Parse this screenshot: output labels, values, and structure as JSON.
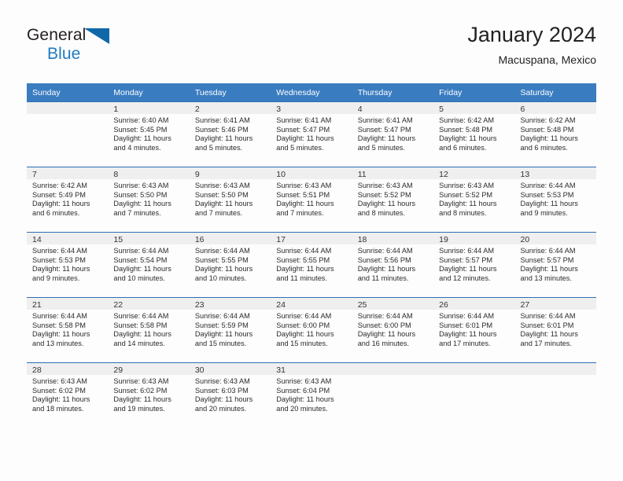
{
  "brand": {
    "name_part1": "General",
    "name_part2": "Blue",
    "logo_icon": "blue-triangle-flag-icon"
  },
  "header": {
    "title": "January 2024",
    "subtitle": "Macuspana, Mexico"
  },
  "colors": {
    "header_blue": "#3a7cc0",
    "grid_line_blue": "#2d6fb5",
    "daybar_gray": "#efefef",
    "brand_blue": "#1f7ac0",
    "logo_triangle": "#1068a8"
  },
  "calendar": {
    "weekday_headers": [
      "Sunday",
      "Monday",
      "Tuesday",
      "Wednesday",
      "Thursday",
      "Friday",
      "Saturday"
    ],
    "weeks": [
      [
        {
          "day": "",
          "sunrise": "",
          "sunset": "",
          "daylight_line1": "",
          "daylight_line2": "",
          "empty": true
        },
        {
          "day": "1",
          "sunrise": "Sunrise: 6:40 AM",
          "sunset": "Sunset: 5:45 PM",
          "daylight_line1": "Daylight: 11 hours",
          "daylight_line2": "and 4 minutes."
        },
        {
          "day": "2",
          "sunrise": "Sunrise: 6:41 AM",
          "sunset": "Sunset: 5:46 PM",
          "daylight_line1": "Daylight: 11 hours",
          "daylight_line2": "and 5 minutes."
        },
        {
          "day": "3",
          "sunrise": "Sunrise: 6:41 AM",
          "sunset": "Sunset: 5:47 PM",
          "daylight_line1": "Daylight: 11 hours",
          "daylight_line2": "and 5 minutes."
        },
        {
          "day": "4",
          "sunrise": "Sunrise: 6:41 AM",
          "sunset": "Sunset: 5:47 PM",
          "daylight_line1": "Daylight: 11 hours",
          "daylight_line2": "and 5 minutes."
        },
        {
          "day": "5",
          "sunrise": "Sunrise: 6:42 AM",
          "sunset": "Sunset: 5:48 PM",
          "daylight_line1": "Daylight: 11 hours",
          "daylight_line2": "and 6 minutes."
        },
        {
          "day": "6",
          "sunrise": "Sunrise: 6:42 AM",
          "sunset": "Sunset: 5:48 PM",
          "daylight_line1": "Daylight: 11 hours",
          "daylight_line2": "and 6 minutes."
        }
      ],
      [
        {
          "day": "7",
          "sunrise": "Sunrise: 6:42 AM",
          "sunset": "Sunset: 5:49 PM",
          "daylight_line1": "Daylight: 11 hours",
          "daylight_line2": "and 6 minutes."
        },
        {
          "day": "8",
          "sunrise": "Sunrise: 6:43 AM",
          "sunset": "Sunset: 5:50 PM",
          "daylight_line1": "Daylight: 11 hours",
          "daylight_line2": "and 7 minutes."
        },
        {
          "day": "9",
          "sunrise": "Sunrise: 6:43 AM",
          "sunset": "Sunset: 5:50 PM",
          "daylight_line1": "Daylight: 11 hours",
          "daylight_line2": "and 7 minutes."
        },
        {
          "day": "10",
          "sunrise": "Sunrise: 6:43 AM",
          "sunset": "Sunset: 5:51 PM",
          "daylight_line1": "Daylight: 11 hours",
          "daylight_line2": "and 7 minutes."
        },
        {
          "day": "11",
          "sunrise": "Sunrise: 6:43 AM",
          "sunset": "Sunset: 5:52 PM",
          "daylight_line1": "Daylight: 11 hours",
          "daylight_line2": "and 8 minutes."
        },
        {
          "day": "12",
          "sunrise": "Sunrise: 6:43 AM",
          "sunset": "Sunset: 5:52 PM",
          "daylight_line1": "Daylight: 11 hours",
          "daylight_line2": "and 8 minutes."
        },
        {
          "day": "13",
          "sunrise": "Sunrise: 6:44 AM",
          "sunset": "Sunset: 5:53 PM",
          "daylight_line1": "Daylight: 11 hours",
          "daylight_line2": "and 9 minutes."
        }
      ],
      [
        {
          "day": "14",
          "sunrise": "Sunrise: 6:44 AM",
          "sunset": "Sunset: 5:53 PM",
          "daylight_line1": "Daylight: 11 hours",
          "daylight_line2": "and 9 minutes."
        },
        {
          "day": "15",
          "sunrise": "Sunrise: 6:44 AM",
          "sunset": "Sunset: 5:54 PM",
          "daylight_line1": "Daylight: 11 hours",
          "daylight_line2": "and 10 minutes."
        },
        {
          "day": "16",
          "sunrise": "Sunrise: 6:44 AM",
          "sunset": "Sunset: 5:55 PM",
          "daylight_line1": "Daylight: 11 hours",
          "daylight_line2": "and 10 minutes."
        },
        {
          "day": "17",
          "sunrise": "Sunrise: 6:44 AM",
          "sunset": "Sunset: 5:55 PM",
          "daylight_line1": "Daylight: 11 hours",
          "daylight_line2": "and 11 minutes."
        },
        {
          "day": "18",
          "sunrise": "Sunrise: 6:44 AM",
          "sunset": "Sunset: 5:56 PM",
          "daylight_line1": "Daylight: 11 hours",
          "daylight_line2": "and 11 minutes."
        },
        {
          "day": "19",
          "sunrise": "Sunrise: 6:44 AM",
          "sunset": "Sunset: 5:57 PM",
          "daylight_line1": "Daylight: 11 hours",
          "daylight_line2": "and 12 minutes."
        },
        {
          "day": "20",
          "sunrise": "Sunrise: 6:44 AM",
          "sunset": "Sunset: 5:57 PM",
          "daylight_line1": "Daylight: 11 hours",
          "daylight_line2": "and 13 minutes."
        }
      ],
      [
        {
          "day": "21",
          "sunrise": "Sunrise: 6:44 AM",
          "sunset": "Sunset: 5:58 PM",
          "daylight_line1": "Daylight: 11 hours",
          "daylight_line2": "and 13 minutes."
        },
        {
          "day": "22",
          "sunrise": "Sunrise: 6:44 AM",
          "sunset": "Sunset: 5:58 PM",
          "daylight_line1": "Daylight: 11 hours",
          "daylight_line2": "and 14 minutes."
        },
        {
          "day": "23",
          "sunrise": "Sunrise: 6:44 AM",
          "sunset": "Sunset: 5:59 PM",
          "daylight_line1": "Daylight: 11 hours",
          "daylight_line2": "and 15 minutes."
        },
        {
          "day": "24",
          "sunrise": "Sunrise: 6:44 AM",
          "sunset": "Sunset: 6:00 PM",
          "daylight_line1": "Daylight: 11 hours",
          "daylight_line2": "and 15 minutes."
        },
        {
          "day": "25",
          "sunrise": "Sunrise: 6:44 AM",
          "sunset": "Sunset: 6:00 PM",
          "daylight_line1": "Daylight: 11 hours",
          "daylight_line2": "and 16 minutes."
        },
        {
          "day": "26",
          "sunrise": "Sunrise: 6:44 AM",
          "sunset": "Sunset: 6:01 PM",
          "daylight_line1": "Daylight: 11 hours",
          "daylight_line2": "and 17 minutes."
        },
        {
          "day": "27",
          "sunrise": "Sunrise: 6:44 AM",
          "sunset": "Sunset: 6:01 PM",
          "daylight_line1": "Daylight: 11 hours",
          "daylight_line2": "and 17 minutes."
        }
      ],
      [
        {
          "day": "28",
          "sunrise": "Sunrise: 6:43 AM",
          "sunset": "Sunset: 6:02 PM",
          "daylight_line1": "Daylight: 11 hours",
          "daylight_line2": "and 18 minutes."
        },
        {
          "day": "29",
          "sunrise": "Sunrise: 6:43 AM",
          "sunset": "Sunset: 6:02 PM",
          "daylight_line1": "Daylight: 11 hours",
          "daylight_line2": "and 19 minutes."
        },
        {
          "day": "30",
          "sunrise": "Sunrise: 6:43 AM",
          "sunset": "Sunset: 6:03 PM",
          "daylight_line1": "Daylight: 11 hours",
          "daylight_line2": "and 20 minutes."
        },
        {
          "day": "31",
          "sunrise": "Sunrise: 6:43 AM",
          "sunset": "Sunset: 6:04 PM",
          "daylight_line1": "Daylight: 11 hours",
          "daylight_line2": "and 20 minutes."
        },
        {
          "day": "",
          "sunrise": "",
          "sunset": "",
          "daylight_line1": "",
          "daylight_line2": "",
          "empty": true
        },
        {
          "day": "",
          "sunrise": "",
          "sunset": "",
          "daylight_line1": "",
          "daylight_line2": "",
          "empty": true
        },
        {
          "day": "",
          "sunrise": "",
          "sunset": "",
          "daylight_line1": "",
          "daylight_line2": "",
          "empty": true
        }
      ]
    ]
  }
}
